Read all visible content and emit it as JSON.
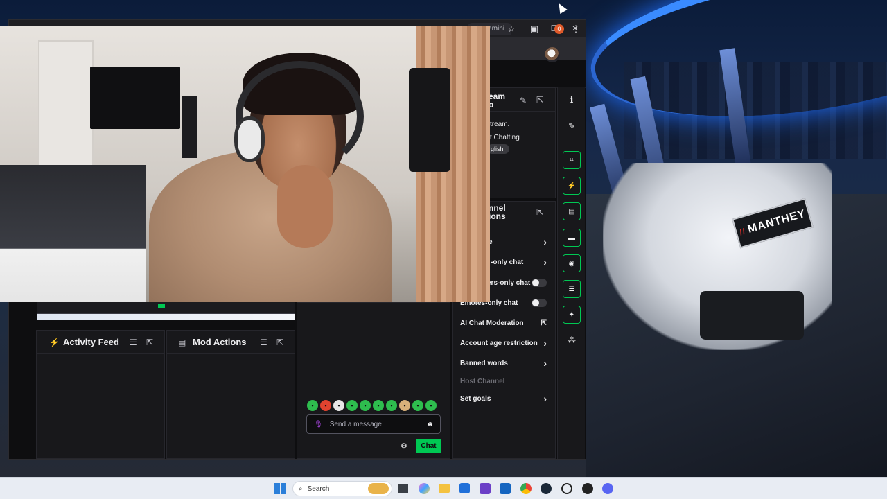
{
  "browser": {
    "tab_label": "Gemini",
    "window_controls": {
      "minimize": "–",
      "maximize": "☐",
      "close": "✕"
    },
    "profile_badge": "0"
  },
  "stream_info": {
    "title": "eam\no",
    "line1": "tream.",
    "category": "t Chatting",
    "language_tag": "glish"
  },
  "channel_actions": {
    "title": "nnel\nions",
    "items": [
      {
        "label": "e",
        "control": "chevron"
      },
      {
        "label": "-only chat",
        "control": "chevron"
      },
      {
        "label": "ers-only chat",
        "control": "toggle"
      },
      {
        "label": "Emotes-only chat",
        "control": "toggle"
      },
      {
        "label": "AI Chat Moderation",
        "control": "external"
      },
      {
        "label": "Account age restriction",
        "control": "chevron"
      },
      {
        "label": "Banned words",
        "control": "chevron"
      },
      {
        "label": "Host Channel",
        "control": "none"
      },
      {
        "label": "Set goals",
        "control": "chevron"
      }
    ]
  },
  "widgets": {
    "activity_feed": "Activity Feed",
    "mod_actions": "Mod Actions"
  },
  "chat": {
    "placeholder": "Send a message",
    "send_label": "Chat"
  },
  "taskbar": {
    "search_label": "Search"
  },
  "wallpaper": {
    "plate_text": "MANTHEY"
  },
  "colors": {
    "accent": "#00c853",
    "panel_bg": "#18181b",
    "page_bg": "#0e0e10"
  }
}
